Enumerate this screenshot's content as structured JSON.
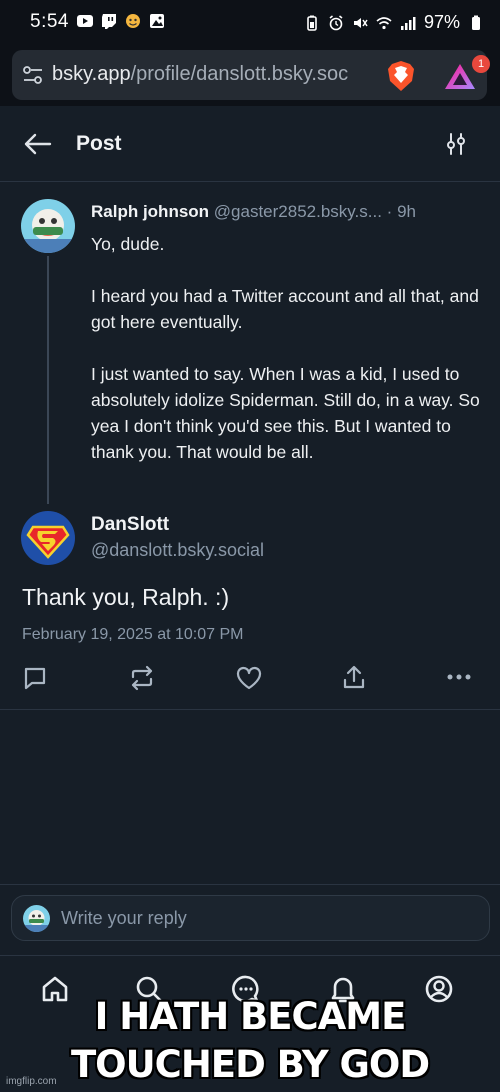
{
  "status_bar": {
    "time": "5:54",
    "battery": "97%"
  },
  "browser": {
    "url_host": "bsky.app",
    "url_path": "/profile/danslott.bsky.soc",
    "notification_count": "1"
  },
  "header": {
    "title": "Post"
  },
  "parent_post": {
    "author_name": "Ralph johnson",
    "author_handle": "@gaster2852.bsky.s...",
    "separator": "·",
    "time": "9h",
    "paragraphs": [
      "Yo, dude.",
      "I heard you had a Twitter account and all that, and got here eventually.",
      "I just wanted to say. When I was a kid, I used to absolutely idolize Spiderman. Still do, in a way. So yea I don't think you'd see this. But I wanted to thank you. That would be all."
    ]
  },
  "main_post": {
    "author_name": "DanSlott",
    "author_handle": "@danslott.bsky.social",
    "text": "Thank you, Ralph. :)",
    "date": "February 19, 2025 at 10:07 PM"
  },
  "reply": {
    "placeholder": "Write your reply"
  },
  "meme_caption": {
    "line1": "I HATH BECAME",
    "line2": "TOUCHED BY GOD"
  },
  "watermark": "imgflip.com",
  "colors": {
    "background": "#161e27",
    "text_primary": "#f1f3f5",
    "text_secondary": "#8a98a8",
    "divider": "#2a3441"
  }
}
